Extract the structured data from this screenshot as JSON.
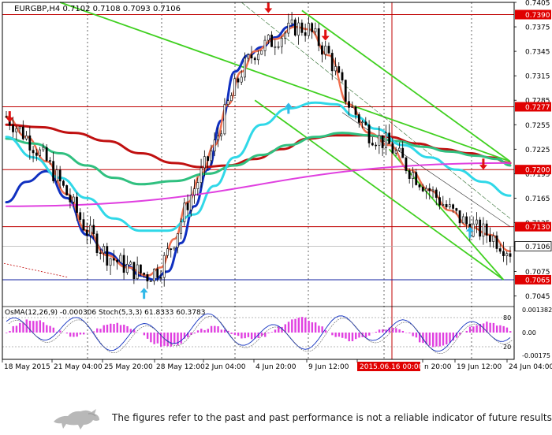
{
  "colors": {
    "candle": "#000000",
    "ma_fast": "#a0a0a0",
    "ma_red_thin": "#d01010",
    "ma_salmon": "#f07050",
    "ma_blue": "#1030c0",
    "ma_cyan": "#30d8e8",
    "ma_green": "#30c080",
    "ma_darkred": "#c01010",
    "channel": "#40d020",
    "magenta": "#e040e0",
    "level_line": "#c00000",
    "level_label_bg": "#e00000",
    "osma": "#e040e0",
    "stoch_main": "#1030c0",
    "arrow_down": "#e01010",
    "arrow_up": "#30b8e8"
  },
  "chart_data": {
    "type": "candlestick",
    "title": "EURGBP,H4  0.7102 0.7108 0.7093 0.7106",
    "symbol": "EURGBP,H4",
    "ohlc_header": [
      "0.7102",
      "0.7108",
      "0.7093",
      "0.7106"
    ],
    "ylim": [
      0.7035,
      0.7405
    ],
    "y_ticks": [
      "0.7405",
      "0.7375",
      "0.7345",
      "0.7315",
      "0.7285",
      "0.7255",
      "0.7225",
      "0.7195",
      "0.7165",
      "0.7135",
      "0.7075",
      "0.7045"
    ],
    "x_ticks": [
      "18 May 2015",
      "21 May 04:00",
      "25 May 20:00",
      "28 May 12:00",
      "2 Jun 04:00",
      "4 Jun 20:00",
      "9 Jun 12:00",
      "2015.06.16 00:00",
      "n 20:00",
      "19 Jun 12:00",
      "24 Jun 04:00"
    ],
    "price_levels": [
      {
        "label": "0.7390",
        "value": 0.739
      },
      {
        "label": "0.7277",
        "value": 0.7277
      },
      {
        "label": "0.7200",
        "value": 0.72
      },
      {
        "label": "0.7130",
        "value": 0.713
      },
      {
        "label": "0.7065",
        "value": 0.7065
      }
    ],
    "current_price": {
      "label": "0.7106",
      "value": 0.7106
    },
    "ma_lines": [
      {
        "color_key": "ma_blue",
        "width": 3,
        "points": [
          [
            0,
            0.716
          ],
          [
            6,
            0.7185
          ],
          [
            12,
            0.7198
          ],
          [
            18,
            0.7165
          ],
          [
            24,
            0.712
          ],
          [
            30,
            0.7098
          ],
          [
            36,
            0.7082
          ],
          [
            40,
            0.707
          ],
          [
            44,
            0.7065
          ],
          [
            48,
            0.7075
          ],
          [
            52,
            0.711
          ],
          [
            56,
            0.7155
          ],
          [
            60,
            0.72
          ],
          [
            64,
            0.726
          ],
          [
            68,
            0.732
          ],
          [
            72,
            0.734
          ],
          [
            76,
            0.735
          ],
          [
            80,
            0.7362
          ],
          [
            84,
            0.7375
          ],
          [
            86,
            0.7378
          ]
        ]
      },
      {
        "color_key": "ma_salmon",
        "width": 2.5,
        "points": [
          [
            0,
            0.7265
          ],
          [
            6,
            0.724
          ],
          [
            12,
            0.721
          ],
          [
            18,
            0.717
          ],
          [
            24,
            0.7125
          ],
          [
            30,
            0.7095
          ],
          [
            36,
            0.708
          ],
          [
            42,
            0.707
          ],
          [
            46,
            0.708
          ],
          [
            50,
            0.7115
          ],
          [
            54,
            0.716
          ],
          [
            58,
            0.7195
          ],
          [
            62,
            0.723
          ],
          [
            66,
            0.728
          ],
          [
            70,
            0.732
          ],
          [
            74,
            0.7345
          ],
          [
            80,
            0.736
          ],
          [
            86,
            0.7375
          ],
          [
            90,
            0.7372
          ],
          [
            96,
            0.734
          ],
          [
            102,
            0.728
          ],
          [
            108,
            0.7245
          ],
          [
            114,
            0.723
          ],
          [
            120,
            0.72
          ],
          [
            126,
            0.7175
          ],
          [
            132,
            0.715
          ],
          [
            138,
            0.713
          ],
          [
            144,
            0.712
          ],
          [
            150,
            0.71
          ]
        ]
      },
      {
        "color_key": "ma_darkred",
        "width": 3,
        "points": [
          [
            0,
            0.7255
          ],
          [
            10,
            0.7252
          ],
          [
            20,
            0.7245
          ],
          [
            30,
            0.7235
          ],
          [
            40,
            0.722
          ],
          [
            50,
            0.7208
          ],
          [
            58,
            0.7203
          ],
          [
            66,
            0.7205
          ],
          [
            74,
            0.7213
          ],
          [
            82,
            0.7225
          ],
          [
            90,
            0.7238
          ],
          [
            98,
            0.7242
          ],
          [
            106,
            0.7242
          ],
          [
            114,
            0.724
          ],
          [
            122,
            0.7232
          ],
          [
            130,
            0.7225
          ],
          [
            138,
            0.722
          ],
          [
            144,
            0.7215
          ],
          [
            150,
            0.7208
          ]
        ]
      },
      {
        "color_key": "ma_green",
        "width": 3,
        "points": [
          [
            0,
            0.7238
          ],
          [
            8,
            0.7232
          ],
          [
            16,
            0.722
          ],
          [
            24,
            0.7205
          ],
          [
            32,
            0.719
          ],
          [
            40,
            0.7182
          ],
          [
            50,
            0.7186
          ],
          [
            60,
            0.7195
          ],
          [
            68,
            0.7205
          ],
          [
            76,
            0.7218
          ],
          [
            84,
            0.723
          ],
          [
            92,
            0.724
          ],
          [
            100,
            0.7245
          ],
          [
            108,
            0.7242
          ],
          [
            116,
            0.7235
          ],
          [
            124,
            0.7228
          ],
          [
            132,
            0.7222
          ],
          [
            140,
            0.7217
          ],
          [
            146,
            0.7213
          ],
          [
            150,
            0.7205
          ]
        ]
      },
      {
        "color_key": "ma_cyan",
        "width": 3,
        "points": [
          [
            0,
            0.724
          ],
          [
            8,
            0.7215
          ],
          [
            16,
            0.719
          ],
          [
            24,
            0.7165
          ],
          [
            32,
            0.714
          ],
          [
            40,
            0.7125
          ],
          [
            48,
            0.7125
          ],
          [
            56,
            0.7145
          ],
          [
            62,
            0.718
          ],
          [
            68,
            0.7215
          ],
          [
            76,
            0.7255
          ],
          [
            84,
            0.7275
          ],
          [
            92,
            0.7282
          ],
          [
            98,
            0.728
          ],
          [
            104,
            0.7265
          ],
          [
            110,
            0.725
          ],
          [
            118,
            0.723
          ],
          [
            126,
            0.7215
          ],
          [
            134,
            0.72
          ],
          [
            142,
            0.7185
          ],
          [
            150,
            0.7168
          ]
        ]
      },
      {
        "color_key": "magenta",
        "width": 2,
        "points": [
          [
            0,
            0.7155
          ],
          [
            150,
            0.7208
          ]
        ]
      }
    ],
    "channel_lines": [
      [
        [
          16,
          0.7405
        ],
        [
          150,
          0.721
        ]
      ],
      [
        [
          88,
          0.7395
        ],
        [
          150,
          0.721
        ]
      ],
      [
        [
          74,
          0.7285
        ],
        [
          148,
          0.7065
        ]
      ],
      [
        [
          114,
          0.7225
        ],
        [
          148,
          0.7065
        ]
      ]
    ],
    "arrows": [
      {
        "dir": "down",
        "i": 1,
        "price": 0.7258
      },
      {
        "dir": "up",
        "i": 41,
        "price": 0.7055
      },
      {
        "dir": "down",
        "i": 78,
        "price": 0.7392
      },
      {
        "dir": "up",
        "i": 84,
        "price": 0.7282
      },
      {
        "dir": "down",
        "i": 95,
        "price": 0.7358
      },
      {
        "dir": "up",
        "i": 138,
        "price": 0.713
      },
      {
        "dir": "down",
        "i": 142,
        "price": 0.72
      }
    ],
    "sub_title": "OsMA(12,26,9) -0.000306  Stoch(5,3,3) 61.8333 60.3783",
    "sub_scale": [
      "0.001382",
      "0.00",
      "-0.00175"
    ],
    "sub_stoch_levels": [
      "80",
      "20"
    ]
  },
  "footer": {
    "disclaimer": "The figures refer to the past and past performance is not a reliable indicator of future results."
  }
}
